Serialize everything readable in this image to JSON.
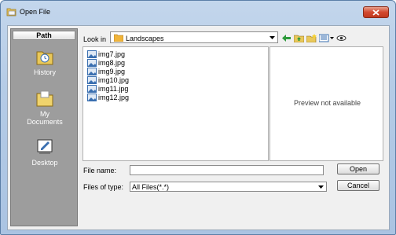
{
  "window": {
    "title": "Open File"
  },
  "sidebar": {
    "header": "Path",
    "items": [
      {
        "label": "History",
        "icon": "history-icon"
      },
      {
        "label": "My Documents",
        "icon": "my-documents-icon"
      },
      {
        "label": "Desktop",
        "icon": "desktop-icon"
      }
    ]
  },
  "lookin": {
    "label": "Look in",
    "value": "Landscapes"
  },
  "toolbar": [
    "back-arrow-icon",
    "up-folder-icon",
    "new-folder-icon",
    "view-menu-icon",
    "preview-eye-icon"
  ],
  "files": [
    "img7.jpg",
    "img8.jpg",
    "img9.jpg",
    "img10.jpg",
    "img11.jpg",
    "img12.jpg"
  ],
  "preview": {
    "text": "Preview not available"
  },
  "form": {
    "file_name_label": "File name:",
    "file_name_value": "",
    "file_type_label": "Files of type:",
    "file_type_value": "All Files(*.*)"
  },
  "buttons": {
    "open": "Open",
    "cancel": "Cancel"
  },
  "colors": {
    "sidebar_bg": "#9d9d9d",
    "window_frame": "#b4cbe6",
    "close_button": "#d2492f"
  }
}
